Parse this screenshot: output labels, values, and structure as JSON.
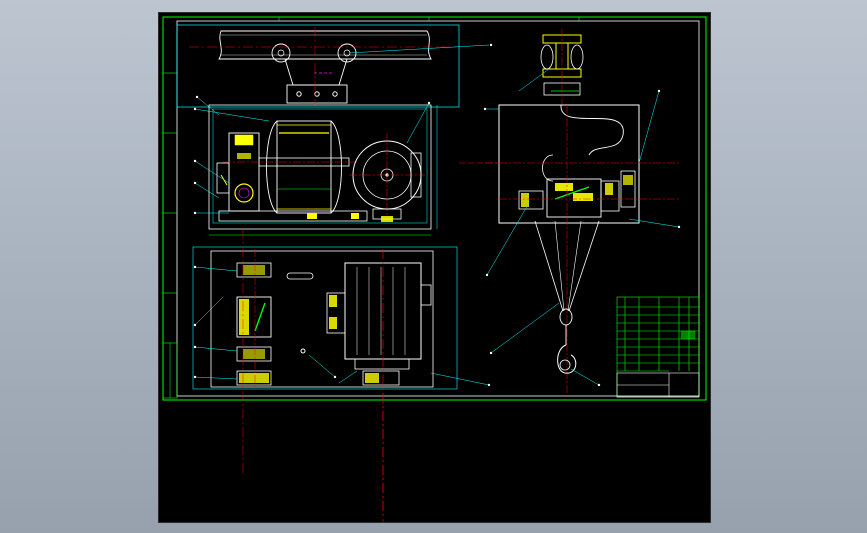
{
  "viewer": {
    "background": "#000000",
    "outer_background": "#a9b3bf"
  },
  "drawing": {
    "colors": {
      "frame": "#00ff00",
      "outline": "#ffffff",
      "centerline": "#ff0000",
      "leader": "#00ffff",
      "part_yellow": "#ffff00",
      "part_green": "#00ff00",
      "dimension_magenta": "#ff00ff"
    },
    "views": [
      "top-trolley-view",
      "front-section-view",
      "side-view",
      "plan-view"
    ],
    "title_block": "green-title-block-bottom-right"
  }
}
